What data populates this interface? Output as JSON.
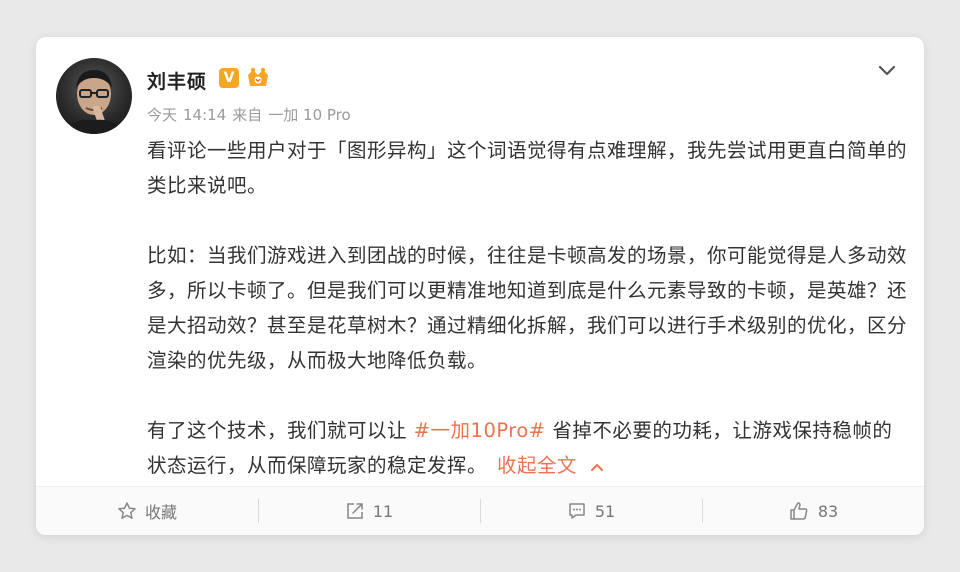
{
  "post": {
    "user": {
      "name": "刘丰硕",
      "verified_badge": "V",
      "vip_badge_icon": "vip-crown-icon"
    },
    "meta": {
      "date": "今天",
      "time": "14:14",
      "source_prefix": "来自",
      "source_device": "一加 10 Pro"
    },
    "content": {
      "p1": "看评论一些用户对于「图形异构」这个词语觉得有点难理解，我先尝试用更直白简单的类比来说吧。",
      "p2": "比如：当我们游戏进入到团战的时候，往往是卡顿高发的场景，你可能觉得是人多动效多，所以卡顿了。但是我们可以更精准地知道到底是什么元素导致的卡顿，是英雄？还是大招动效？甚至是花草树木？通过精细化拆解，我们可以进行手术级别的优化，区分渲染的优先级，从而极大地降低负载。",
      "p3_before": "有了这个技术，我们就可以让 ",
      "hashtag": "#一加10Pro#",
      "p3_after": " 省掉不必要的功耗，让游戏保持稳帧的状态运行，从而保障玩家的稳定发挥。",
      "collapse_label": "收起全文"
    },
    "actions": {
      "favorite_label": "收藏",
      "repost_count": "11",
      "comment_count": "51",
      "like_count": "83"
    }
  },
  "colors": {
    "accent": "#eb7350",
    "verified": "#f5a623",
    "meta_text": "#9a9a9a"
  }
}
